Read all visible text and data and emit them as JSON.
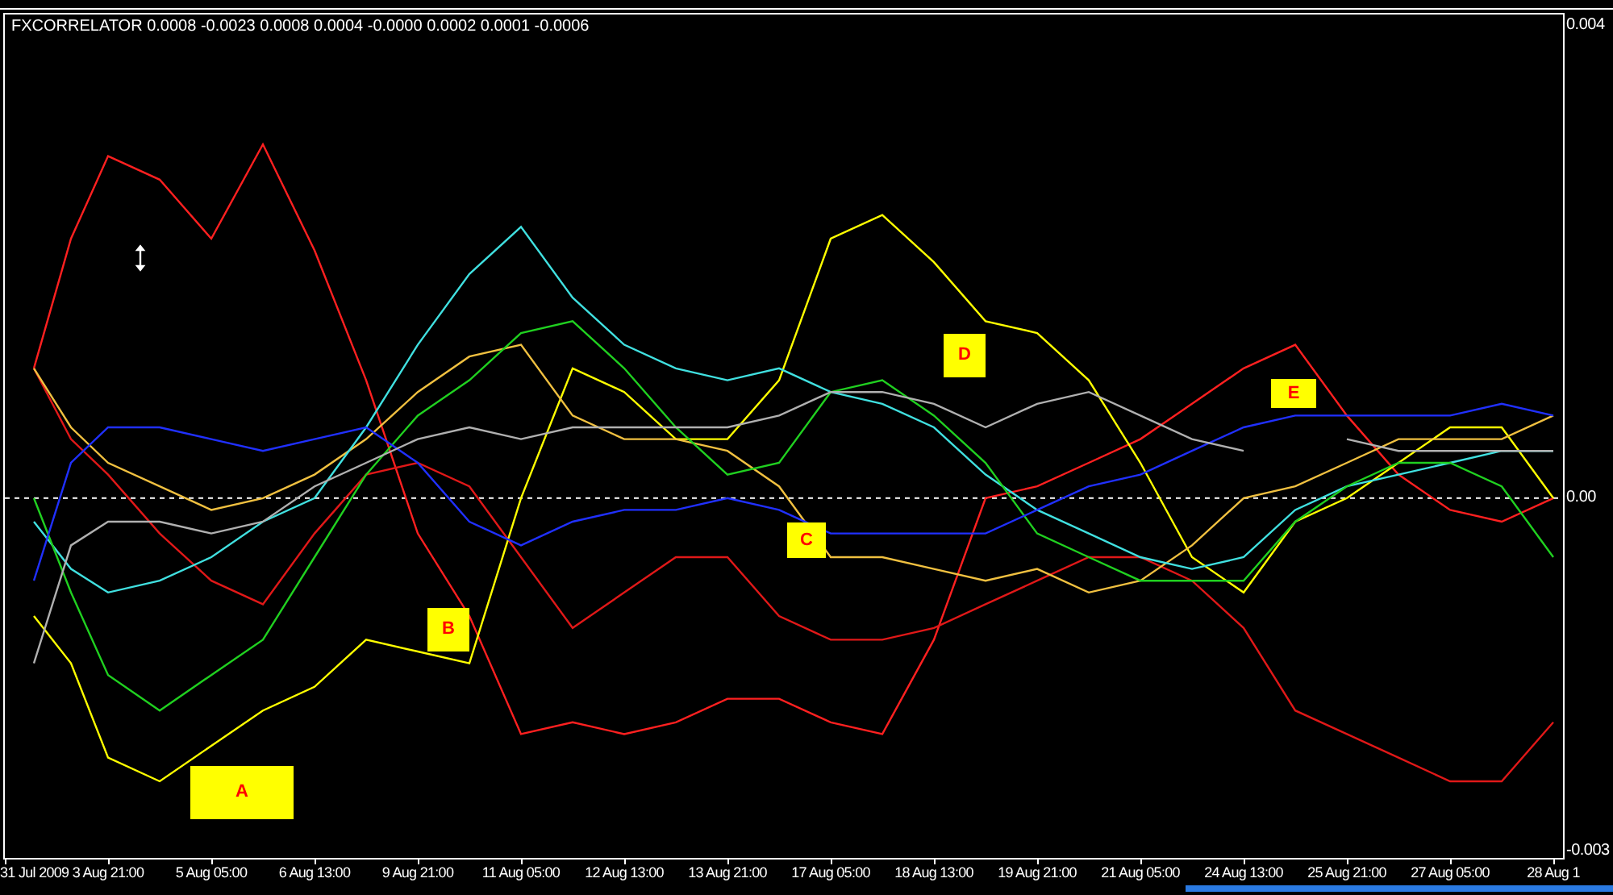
{
  "indicator": {
    "label": "FXCORRELATOR 0.0008 -0.0023 0.0008 0.0004 -0.0000 0.0002 0.0001 -0.0006"
  },
  "markers": [
    {
      "label": "A"
    },
    {
      "label": "B"
    },
    {
      "label": "C"
    },
    {
      "label": "D"
    },
    {
      "label": "E"
    }
  ],
  "chart_data": {
    "type": "line",
    "categories": [
      "31 Jul 2009",
      null,
      "3 Aug 21:00",
      null,
      "5 Aug 05:00",
      null,
      "6 Aug 13:00",
      null,
      "9 Aug 21:00",
      null,
      "11 Aug 05:00",
      null,
      "12 Aug 13:00",
      null,
      "13 Aug 21:00",
      null,
      "17 Aug 05:00",
      null,
      "18 Aug 13:00",
      null,
      "19 Aug 21:00",
      null,
      "21 Aug 05:00",
      null,
      "24 Aug 13:00",
      null,
      "25 Aug 21:00",
      null,
      "27 Aug 05:00",
      null,
      "28 Aug 1"
    ],
    "ylim": [
      -0.00305,
      0.0041
    ],
    "yticks": [
      {
        "value": 0.004,
        "label": "0.004"
      },
      {
        "value": 0,
        "label": "0.00"
      },
      {
        "value": -0.003,
        "label": "-0.003"
      }
    ],
    "series": [
      {
        "color": "#ff2020",
        "values": [
          0.0011,
          0.0022,
          0.0029,
          0.0027,
          0.0022,
          0.003,
          0.0021,
          0.001,
          -0.0003,
          -0.001,
          -0.002,
          -0.0019,
          -0.002,
          -0.0019,
          -0.0017,
          -0.0017,
          -0.0019,
          -0.002,
          -0.0012,
          0.0,
          0.0001,
          0.0003,
          0.0005,
          0.0008,
          0.0011,
          0.0013,
          0.0007,
          0.0002,
          -0.0001,
          -0.0002,
          0.0
        ]
      },
      {
        "color": "#e01818",
        "values": [
          0.0011,
          0.0005,
          0.0002,
          -0.0003,
          -0.0007,
          -0.0009,
          -0.0003,
          0.0002,
          0.0003,
          0.0001,
          -0.0005,
          -0.0011,
          -0.0008,
          -0.0005,
          -0.0005,
          -0.001,
          -0.0012,
          -0.0012,
          -0.0011,
          -0.0009,
          -0.0007,
          -0.0005,
          -0.0005,
          -0.0007,
          -0.0011,
          -0.0018,
          -0.002,
          -0.0022,
          -0.0024,
          -0.0024,
          -0.0019
        ]
      },
      {
        "color": "#ffff00",
        "values": [
          -0.001,
          -0.0014,
          -0.0022,
          -0.0024,
          -0.0021,
          -0.0018,
          -0.0016,
          -0.0012,
          -0.0013,
          -0.0014,
          0.0,
          0.0011,
          0.0009,
          0.0005,
          0.0005,
          0.001,
          0.0022,
          0.0024,
          0.002,
          0.0015,
          0.0014,
          0.001,
          0.0003,
          -0.0005,
          -0.0008,
          -0.0002,
          0.0,
          0.0003,
          0.0006,
          0.0006,
          0.0
        ]
      },
      {
        "color": "#f0c040",
        "values": [
          0.0011,
          0.0006,
          0.0003,
          0.0001,
          -0.0001,
          0.0,
          0.0002,
          0.0005,
          0.0009,
          0.0012,
          0.0013,
          0.0007,
          0.0005,
          0.0005,
          0.0004,
          0.0001,
          -0.0005,
          -0.0005,
          -0.0006,
          -0.0007,
          -0.0006,
          -0.0008,
          -0.0007,
          -0.0004,
          0.0,
          0.0001,
          0.0003,
          0.0005,
          0.0005,
          0.0005,
          0.0007
        ]
      },
      {
        "color": "#40e0e0",
        "values": [
          -0.0002,
          -0.0006,
          -0.0008,
          -0.0007,
          -0.0005,
          -0.0002,
          0.0,
          0.0006,
          0.0013,
          0.0019,
          0.0023,
          0.0017,
          0.0013,
          0.0011,
          0.001,
          0.0011,
          0.0009,
          0.0008,
          0.0006,
          0.0002,
          -0.0001,
          -0.0003,
          -0.0005,
          -0.0006,
          -0.0005,
          -0.0001,
          0.0001,
          0.0002,
          0.0003,
          0.0004,
          0.0004
        ]
      },
      {
        "color": "#20d020",
        "values": [
          0.0,
          -0.0008,
          -0.0015,
          -0.0018,
          -0.0015,
          -0.0012,
          -0.0005,
          0.0002,
          0.0007,
          0.001,
          0.0014,
          0.0015,
          0.0011,
          0.0006,
          0.0002,
          0.0003,
          0.0009,
          0.001,
          0.0007,
          0.0003,
          -0.0003,
          -0.0005,
          -0.0007,
          -0.0007,
          -0.0007,
          -0.0002,
          0.0001,
          0.0003,
          0.0003,
          0.0001,
          -0.0005
        ]
      },
      {
        "color": "#2030ff",
        "values": [
          -0.0007,
          0.0003,
          0.0006,
          0.0006,
          0.0005,
          0.0004,
          0.0005,
          0.0006,
          0.0003,
          -0.0002,
          -0.0004,
          -0.0002,
          -0.0001,
          -0.0001,
          0.0,
          -0.0001,
          -0.0003,
          -0.0003,
          -0.0003,
          -0.0003,
          -0.0001,
          0.0001,
          0.0002,
          0.0004,
          0.0006,
          0.0007,
          0.0007,
          0.0007,
          0.0007,
          0.0008,
          0.0007
        ]
      },
      {
        "color": "#b0b0b0",
        "values": [
          -0.0014,
          -0.0004,
          -0.0002,
          -0.0002,
          -0.0003,
          -0.0002,
          0.0001,
          0.0003,
          0.0005,
          0.0006,
          0.0005,
          0.0006,
          0.0006,
          0.0006,
          0.0006,
          0.0007,
          0.0009,
          0.0009,
          0.0008,
          0.0006,
          0.0008,
          0.0009,
          0.0007,
          0.0005,
          0.0004,
          null,
          0.0005,
          0.0004,
          0.0004,
          0.0004,
          0.0004
        ]
      }
    ]
  }
}
